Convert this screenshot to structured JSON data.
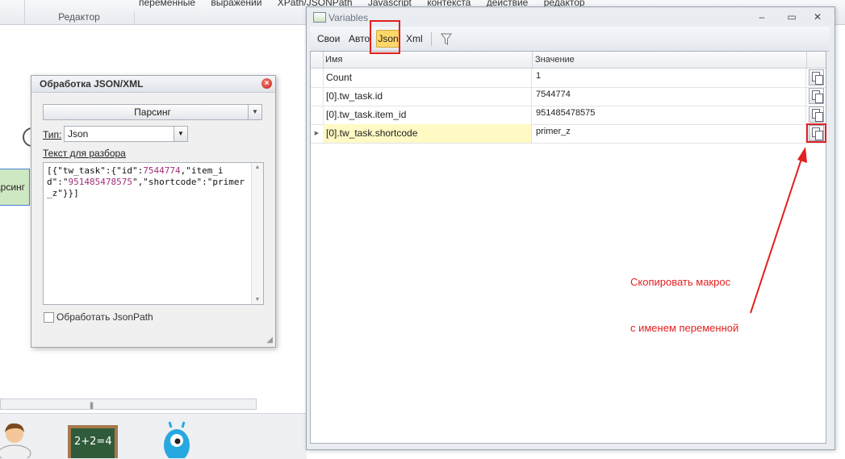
{
  "ribbon": {
    "group_label": "Редактор",
    "tabs": [
      "переменные",
      "выражении",
      "XPath/JSONPath",
      "Javascript",
      "контекста",
      "действие",
      "редактор"
    ]
  },
  "canvas": {
    "node_label": "арсинг"
  },
  "json_dialog": {
    "title": "Обработка JSON/XML",
    "mode_button": "Парсинг",
    "type_label": "Тип:",
    "type_value": "Json",
    "text_label": "Текст для разбора",
    "text_content": {
      "p1": "[{\"tw_task\":{\"id\":",
      "n1": "7544774",
      "p2": ",\"item_id\":\"",
      "n2": "951485478575",
      "p3": "\",\"shortcode\":\"primer_z\"}}]"
    },
    "checkbox_label": "Обработать JsonPath",
    "checkbox_checked": false
  },
  "variables_window": {
    "title": "Variables",
    "toolbar": {
      "own": "Свои",
      "auto": "Авто",
      "json": "Json",
      "xml": "Xml"
    },
    "columns": {
      "name": "Имя",
      "value": "Значение"
    },
    "rows": [
      {
        "name": "Count",
        "value": "1"
      },
      {
        "name": "[0].tw_task.id",
        "value": "7544774"
      },
      {
        "name": "[0].tw_task.item_id",
        "value": "951485478575"
      },
      {
        "name": "[0].tw_task.shortcode",
        "value": "primer_z"
      }
    ]
  },
  "annotation": {
    "line1": "Скопировать макрос",
    "line2": "с именем переменной",
    "color": "#e41f1f"
  }
}
